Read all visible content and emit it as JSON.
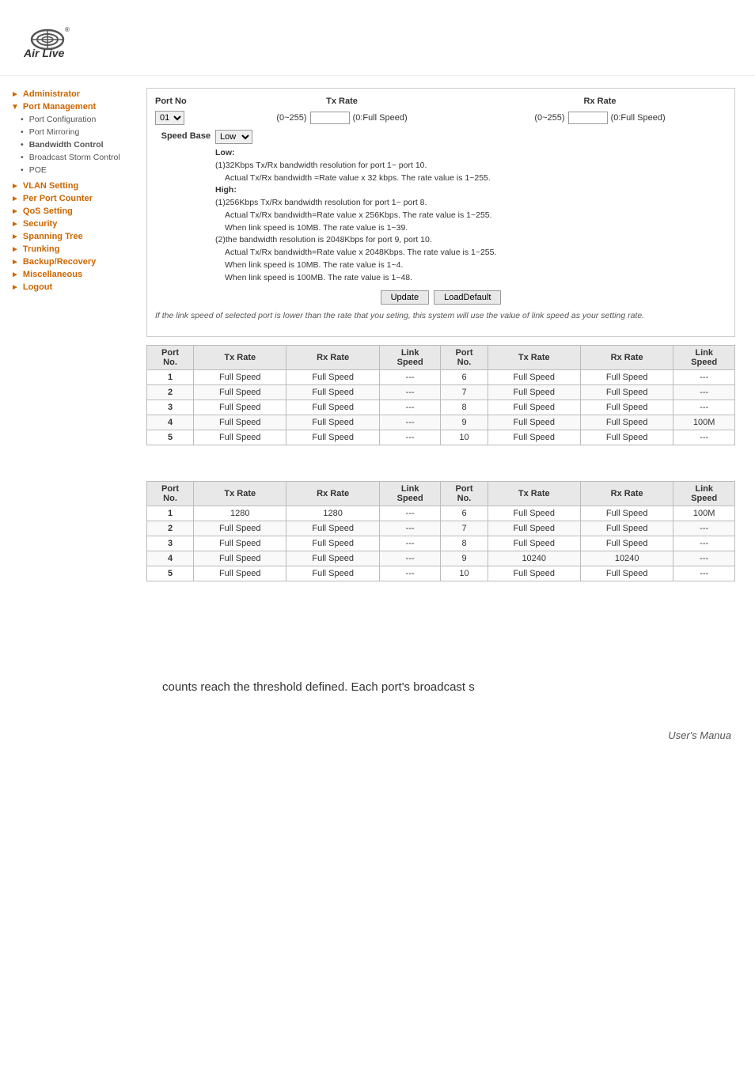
{
  "header": {
    "logo_alt": "Air Live"
  },
  "sidebar": {
    "sections": [
      {
        "id": "administrator",
        "label": "Administrator",
        "type": "section-header",
        "arrow": "►"
      },
      {
        "id": "port-management",
        "label": "Port Management",
        "type": "section-header",
        "arrow": "▼",
        "active": true
      },
      {
        "id": "port-configuration",
        "label": "Port Configuration",
        "type": "sub"
      },
      {
        "id": "port-mirroring",
        "label": "Port Mirroring",
        "type": "sub"
      },
      {
        "id": "bandwidth-control",
        "label": "Bandwidth Control",
        "type": "sub",
        "active": true
      },
      {
        "id": "broadcast-storm-control",
        "label": "Broadcast Storm Control",
        "type": "sub"
      },
      {
        "id": "poe",
        "label": "POE",
        "type": "sub"
      },
      {
        "id": "vlan-setting",
        "label": "VLAN Setting",
        "type": "section-header",
        "arrow": "►"
      },
      {
        "id": "per-port-counter",
        "label": "Per Port Counter",
        "type": "section-header",
        "arrow": "►"
      },
      {
        "id": "qos-setting",
        "label": "QoS Setting",
        "type": "section-header",
        "arrow": "►"
      },
      {
        "id": "security",
        "label": "Security",
        "type": "section-header",
        "arrow": "►"
      },
      {
        "id": "spanning-tree",
        "label": "Spanning Tree",
        "type": "section-header",
        "arrow": "►"
      },
      {
        "id": "trunking",
        "label": "Trunking",
        "type": "section-header",
        "arrow": "►"
      },
      {
        "id": "backup-recovery",
        "label": "Backup/Recovery",
        "type": "section-header",
        "arrow": "►"
      },
      {
        "id": "miscellaneous",
        "label": "Miscellaneous",
        "type": "section-header",
        "arrow": "►"
      },
      {
        "id": "logout",
        "label": "Logout",
        "type": "section-header",
        "arrow": "►"
      }
    ]
  },
  "form": {
    "port_no_label": "Port No",
    "tx_rate_label": "Tx Rate",
    "rx_rate_label": "Rx Rate",
    "port_default": "01",
    "tx_range_label": "(0~255)",
    "tx_placeholder": "",
    "tx_full_speed": "(0:Full Speed)",
    "rx_range_label": "(0~255)",
    "rx_placeholder": "",
    "rx_full_speed": "(0:Full Speed)",
    "speed_base_label": "Speed Base",
    "speed_base_default": "Low",
    "speed_desc": {
      "low_title": "Low:",
      "low_desc1": "(1)32Kbps Tx/Rx bandwidth resolution for port 1~ port 10.",
      "low_desc2": "Actual Tx/Rx bandwidth =Rate value x 32 kbps. The rate value is 1~255.",
      "high_title": "High:",
      "high_desc1": "(1)256Kbps Tx/Rx bandwidth resolution for port 1~ port 8.",
      "high_desc2": "Actual Tx/Rx bandwidth=Rate value x 256Kbps. The rate value is 1~255.",
      "high_desc3": "When link speed is 10MB. The rate value is 1~39.",
      "high_desc4": "(2)the bandwidth resolution is 2048Kbps for port 9, port 10.",
      "high_desc5": "Actual Tx/Rx bandwidth=Rate value x 2048Kbps. The rate value is 1~255.",
      "high_desc6": "When link speed is 10MB. The rate value is 1~4.",
      "high_desc7": "When link speed is 100MB. The rate value is 1~48."
    },
    "update_btn": "Update",
    "load_default_btn": "LoadDefault"
  },
  "note": "If the link speed of selected port is lower than the rate that you seting, this system will use the value of link speed as your setting rate.",
  "table1": {
    "headers": [
      "Port No.",
      "Tx  Rate",
      "Rx  Rate",
      "Link Speed",
      "Port No.",
      "Tx  Rate",
      "Rx  Rate",
      "Link Speed"
    ],
    "rows": [
      {
        "port1": "1",
        "tx1": "Full Speed",
        "rx1": "Full Speed",
        "link1": "---",
        "port2": "6",
        "tx2": "Full Speed",
        "rx2": "Full Speed",
        "link2": "---"
      },
      {
        "port1": "2",
        "tx1": "Full Speed",
        "rx1": "Full Speed",
        "link1": "---",
        "port2": "7",
        "tx2": "Full Speed",
        "rx2": "Full Speed",
        "link2": "---"
      },
      {
        "port1": "3",
        "tx1": "Full Speed",
        "rx1": "Full Speed",
        "link1": "---",
        "port2": "8",
        "tx2": "Full Speed",
        "rx2": "Full Speed",
        "link2": "---"
      },
      {
        "port1": "4",
        "tx1": "Full Speed",
        "rx1": "Full Speed",
        "link1": "---",
        "port2": "9",
        "tx2": "Full Speed",
        "rx2": "Full Speed",
        "link2": "100M"
      },
      {
        "port1": "5",
        "tx1": "Full Speed",
        "rx1": "Full Speed",
        "link1": "---",
        "port2": "10",
        "tx2": "Full Speed",
        "rx2": "Full Speed",
        "link2": "---"
      }
    ]
  },
  "table2": {
    "headers": [
      "Port No.",
      "Tx  Rate",
      "Rx  Rate",
      "Link Speed",
      "Port No.",
      "Tx  Rate",
      "Rx  Rate",
      "Link Speed"
    ],
    "rows": [
      {
        "port1": "1",
        "tx1": "1280",
        "rx1": "1280",
        "link1": "---",
        "port2": "6",
        "tx2": "Full Speed",
        "rx2": "Full Speed",
        "link2": "100M"
      },
      {
        "port1": "2",
        "tx1": "Full Speed",
        "rx1": "Full Speed",
        "link1": "---",
        "port2": "7",
        "tx2": "Full Speed",
        "rx2": "Full Speed",
        "link2": "---"
      },
      {
        "port1": "3",
        "tx1": "Full Speed",
        "rx1": "Full Speed",
        "link1": "---",
        "port2": "8",
        "tx2": "Full Speed",
        "rx2": "Full Speed",
        "link2": "---"
      },
      {
        "port1": "4",
        "tx1": "Full Speed",
        "rx1": "Full Speed",
        "link1": "---",
        "port2": "9",
        "tx2": "10240",
        "rx2": "10240",
        "link2": "---"
      },
      {
        "port1": "5",
        "tx1": "Full Speed",
        "rx1": "Full Speed",
        "link1": "---",
        "port2": "10",
        "tx2": "Full Speed",
        "rx2": "Full Speed",
        "link2": "---"
      }
    ]
  },
  "footer": {
    "text": "counts reach the threshold defined. Each port's broadcast s",
    "user_manual": "User's Manua"
  }
}
